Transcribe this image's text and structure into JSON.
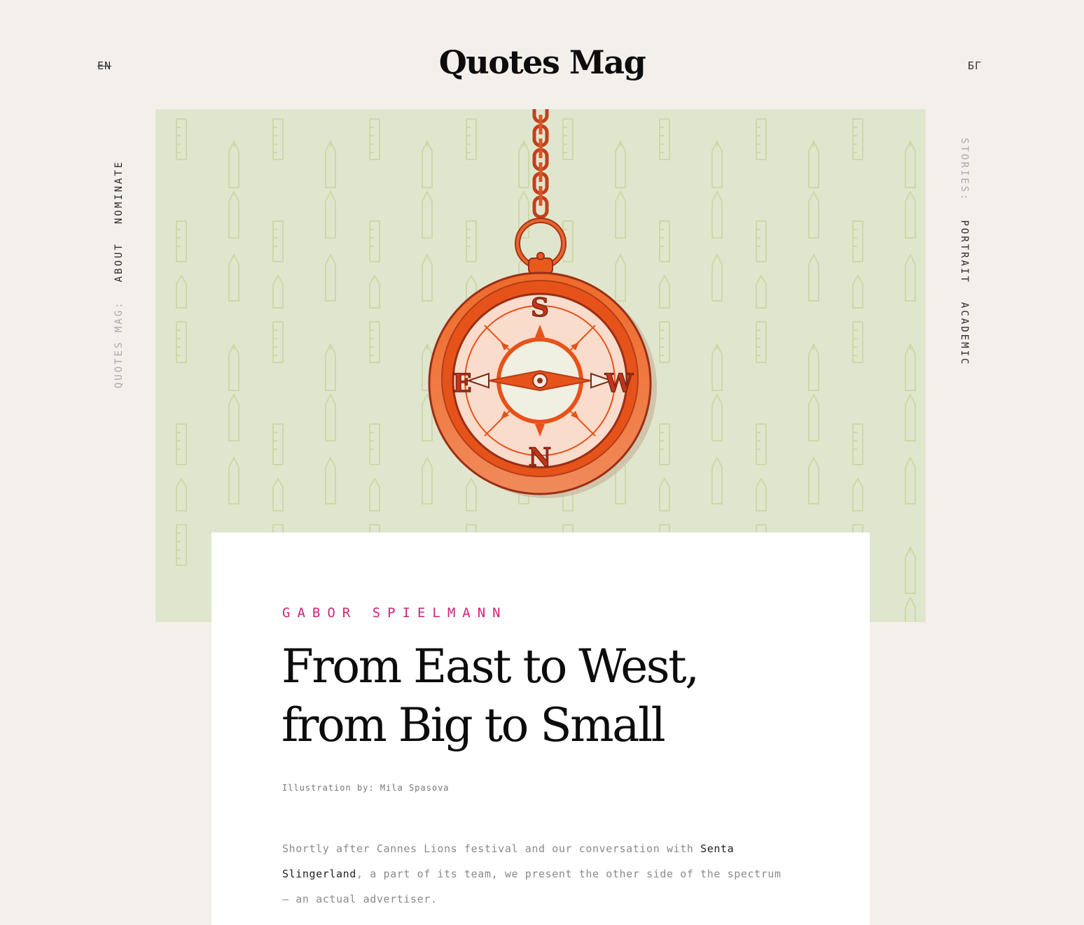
{
  "header": {
    "logo": "Quotes Mag",
    "lang_en": "EN",
    "lang_bg": "БГ"
  },
  "left_nav": {
    "label": "QUOTES MAG:",
    "items": [
      "ABOUT",
      "NOMINATE"
    ]
  },
  "right_nav": {
    "label": "STORIES:",
    "items": [
      "PORTRAIT",
      "ACADEMIC"
    ]
  },
  "hero": {
    "compass_letters": {
      "north": "N",
      "south": "S",
      "east": "E",
      "west": "W"
    },
    "colors": {
      "background": "#e0e6cd",
      "pattern": "#cdd8a8",
      "compass": "#e85a1c",
      "face": "#f9dccb"
    }
  },
  "article": {
    "author": "GABOR SPIELMANN",
    "title_line1": "From East to West,",
    "title_line2": "from Big to Small",
    "credit": "Illustration by: Mila Spasova",
    "lede_part1": "Shortly after Cannes Lions festival and our conversation with ",
    "lede_person": "Senta Slingerland",
    "lede_part2": ", a part of its team, we present the other side of the spectrum — an actual advertiser."
  }
}
